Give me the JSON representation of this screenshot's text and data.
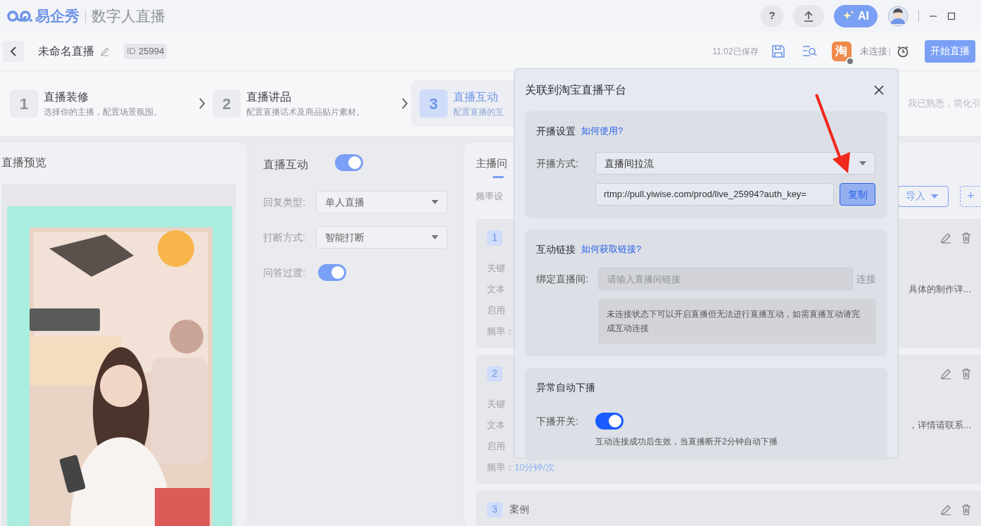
{
  "title_bar": {
    "brand": "易企秀",
    "app_name": "数字人直播",
    "help": "?",
    "ai_button": "AI"
  },
  "toolbar": {
    "title": "未命名直播",
    "id_label": "ID",
    "id_value": "25994",
    "saved": "11:02已保存",
    "platform_icon": "淘",
    "connection_status": "未连接",
    "separator": "|",
    "start_button": "开始直播"
  },
  "steps": [
    {
      "number": "1",
      "title": "直播装修",
      "subtitle": "选择你的主播，配置场景氛围。",
      "selected": false
    },
    {
      "number": "2",
      "title": "直播讲品",
      "subtitle": "配置直播话术及商品贴片素材。",
      "selected": false
    },
    {
      "number": "3",
      "title": "直播互动",
      "subtitle": "配置直播的互",
      "selected": true
    }
  ],
  "simplify_link": "我已熟悉，简化引",
  "preview": {
    "title": "直播预览",
    "kind": "picture"
  },
  "interaction_panel": {
    "title": "直播互动",
    "on": true,
    "fields": [
      {
        "kind": "select",
        "label": "回复类型:",
        "value": "单人直播"
      },
      {
        "kind": "select",
        "label": "打断方式:",
        "value": "智能打断"
      },
      {
        "kind": "toggle",
        "label": "问答过渡:",
        "on": true
      }
    ]
  },
  "qa_panel": {
    "tab": "主播问",
    "frequency_label": "频率设",
    "import_button": "导入",
    "add_button": "+",
    "items": [
      {
        "number": "1",
        "lines": [
          {
            "label": "关键"
          },
          {
            "label": "文本",
            "value": "具体的制作详..."
          },
          {
            "label": "启用"
          },
          {
            "label": "频率："
          }
        ]
      },
      {
        "number": "2",
        "lines": [
          {
            "label": "关键"
          },
          {
            "label": "文本",
            "value": "，详情请联系..."
          },
          {
            "label": "启用"
          },
          {
            "label": "频率：",
            "value_left": "10分钟/次"
          }
        ]
      },
      {
        "number": "3",
        "title": "案例"
      }
    ]
  },
  "dialog": {
    "title": "关联到淘宝直播平台",
    "sections": [
      {
        "kind": "stream",
        "title": "开播设置",
        "link": "如何使用?",
        "label": "开播方式:",
        "value": "直播间拉流",
        "url": "rtmp://pull.yiwise.com/prod/live_25994?auth_key=",
        "button": "复制"
      },
      {
        "kind": "bind",
        "title": "互动链接",
        "link": "如何获取链接?",
        "label": "绑定直播间:",
        "placeholder": "请输入直播间链接",
        "button": "连接",
        "disabled": true,
        "note": "未连接状态下可以开启直播但无法进行直播互动，如需直播互动请完成互动连接"
      },
      {
        "kind": "auto_stop",
        "title": "异常自动下播",
        "label": "下播开关:",
        "on": true,
        "note": "互动连接成功后生效，当直播断开2分钟自动下播"
      }
    ]
  }
}
